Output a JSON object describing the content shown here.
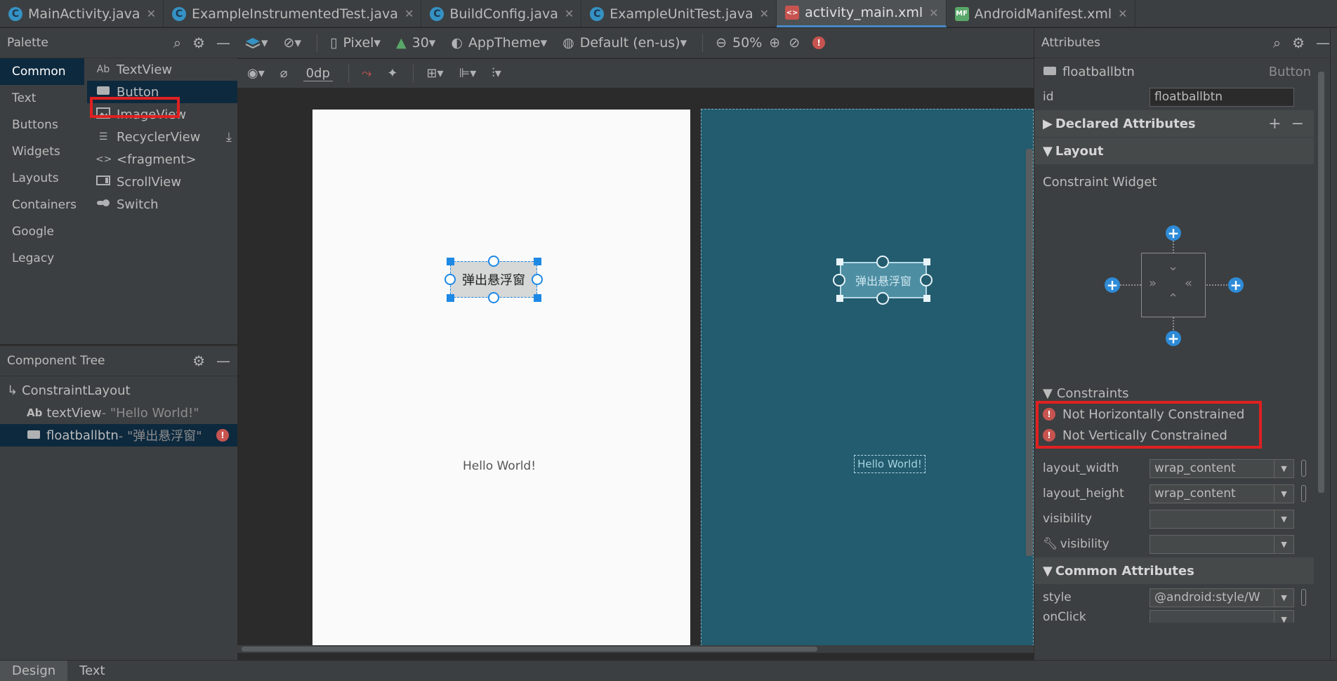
{
  "tabs": [
    {
      "label": "MainActivity.java",
      "icon": "C"
    },
    {
      "label": "ExampleInstrumentedTest.java",
      "icon": "C"
    },
    {
      "label": "BuildConfig.java",
      "icon": "C"
    },
    {
      "label": "ExampleUnitTest.java",
      "icon": "C"
    },
    {
      "label": "activity_main.xml",
      "icon": "<>"
    },
    {
      "label": "AndroidManifest.xml",
      "icon": "MF"
    }
  ],
  "palette": {
    "title": "Palette",
    "categories": [
      "Common",
      "Text",
      "Buttons",
      "Widgets",
      "Layouts",
      "Containers",
      "Google",
      "Legacy"
    ],
    "items": [
      {
        "label": "TextView",
        "icon": "Ab"
      },
      {
        "label": "Button"
      },
      {
        "label": "ImageView"
      },
      {
        "label": "RecyclerView"
      },
      {
        "label": "<fragment>",
        "icon": "<>"
      },
      {
        "label": "ScrollView"
      },
      {
        "label": "Switch"
      }
    ]
  },
  "tree": {
    "title": "Component Tree",
    "root": "ConstraintLayout",
    "nodes": [
      {
        "name": "textView",
        "icon": "Ab",
        "value": "- \"Hello World!\""
      },
      {
        "name": "floatballbtn",
        "value": "- \"弹出悬浮窗\""
      }
    ]
  },
  "toolbar": {
    "device": "Pixel",
    "api": "30",
    "theme": "AppTheme",
    "locale": "Default (en-us)",
    "zoom": "50%",
    "margin": "0dp"
  },
  "canvas": {
    "button_text": "弹出悬浮窗",
    "hello_text": "Hello World!"
  },
  "attributes": {
    "title": "Attributes",
    "component": "floatballbtn",
    "component_type": "Button",
    "id_label": "id",
    "id_value": "floatballbtn",
    "sections": {
      "declared": "Declared Attributes",
      "layout": "Layout",
      "common": "Common Attributes"
    },
    "constraint_widget": "Constraint Widget",
    "constraints_title": "Constraints",
    "warnings": [
      "Not Horizontally Constrained",
      "Not Vertically Constrained"
    ],
    "rows": [
      {
        "name": "layout_width",
        "value": "wrap_content"
      },
      {
        "name": "layout_height",
        "value": "wrap_content"
      },
      {
        "name": "visibility",
        "value": ""
      },
      {
        "name": "visibility",
        "value": ""
      }
    ],
    "style_label": "style",
    "style_value": "@android:style/W",
    "onclick_label": "onClick"
  },
  "bottom_tabs": [
    "Design",
    "Text"
  ],
  "colors": {
    "accent": "#1e88e5",
    "blueprint": "#225c6e",
    "error": "#c75450",
    "highlight": "#e02020"
  }
}
